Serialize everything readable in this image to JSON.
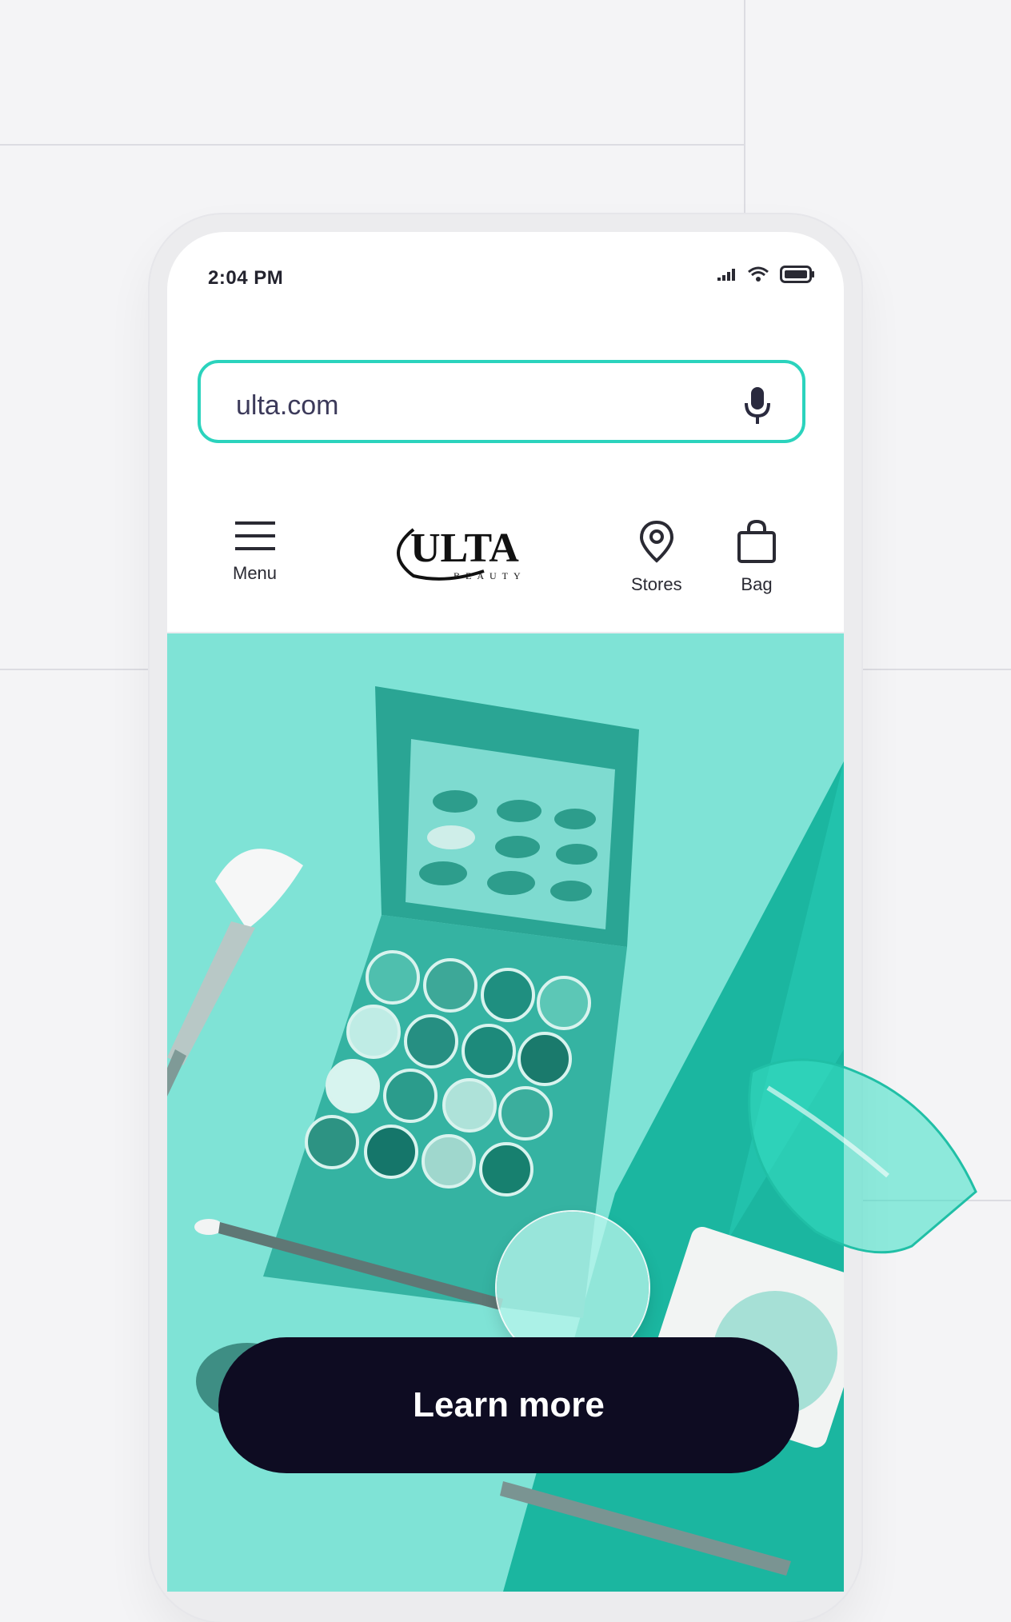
{
  "status_bar": {
    "time": "2:04 PM",
    "icons": [
      "signal-icon",
      "wifi-icon",
      "battery-icon"
    ]
  },
  "browser": {
    "url": "ulta.com",
    "mic_icon": "microphone-icon"
  },
  "site_header": {
    "menu_label": "Menu",
    "logo_text": "ULTA",
    "logo_subtext": "BEAUTY",
    "stores_label": "Stores",
    "bag_label": "Bag"
  },
  "hero": {
    "cta_label": "Learn more"
  },
  "colors": {
    "accent_teal": "#2bd3bd",
    "hero_bg": "#7fe3d6",
    "cta_bg": "#0e0c22"
  }
}
